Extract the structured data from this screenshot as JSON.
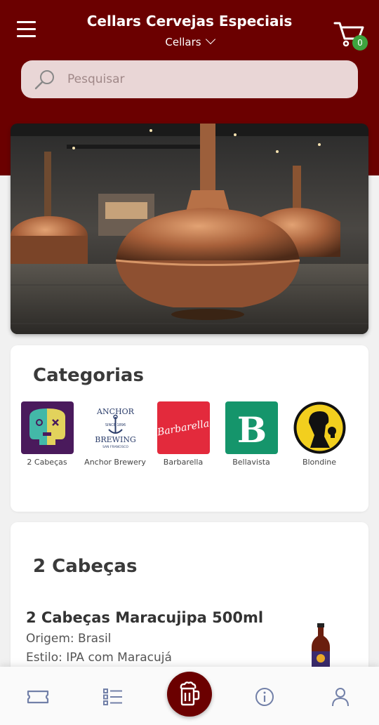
{
  "header": {
    "title": "Cellars Cervejas Especiais",
    "store": "Cellars",
    "cart_count": "0"
  },
  "search": {
    "placeholder": "Pesquisar"
  },
  "categories": {
    "title": "Categorias",
    "items": [
      {
        "label": "2 Cabeças"
      },
      {
        "label": "Anchor Brewery"
      },
      {
        "label": "Barbarella"
      },
      {
        "label": "Bellavista"
      },
      {
        "label": "Blondine"
      }
    ],
    "logo_text": {
      "anchor_top": "ANCHOR",
      "anchor_since": "SINCE 1896",
      "anchor_bottom": "BREWING",
      "anchor_city": "SAN FRANCISCO",
      "barbarella": "Barbarella",
      "bellavista": "B"
    }
  },
  "product_section": {
    "title": "2 Cabeças",
    "product": {
      "name": "2 Cabeças Maracujipa 500ml",
      "origin": "Origem: Brasil",
      "style": "Estilo: IPA com Maracujá"
    }
  },
  "bottom_nav": {
    "items": [
      "ticket-icon",
      "list-icon",
      "beer-mug-icon",
      "info-icon",
      "user-icon"
    ]
  },
  "colors": {
    "brand": "#6b0000",
    "badge": "#3ea33e",
    "search_bg": "#e9d6d6",
    "copper": "#b66a3e"
  }
}
